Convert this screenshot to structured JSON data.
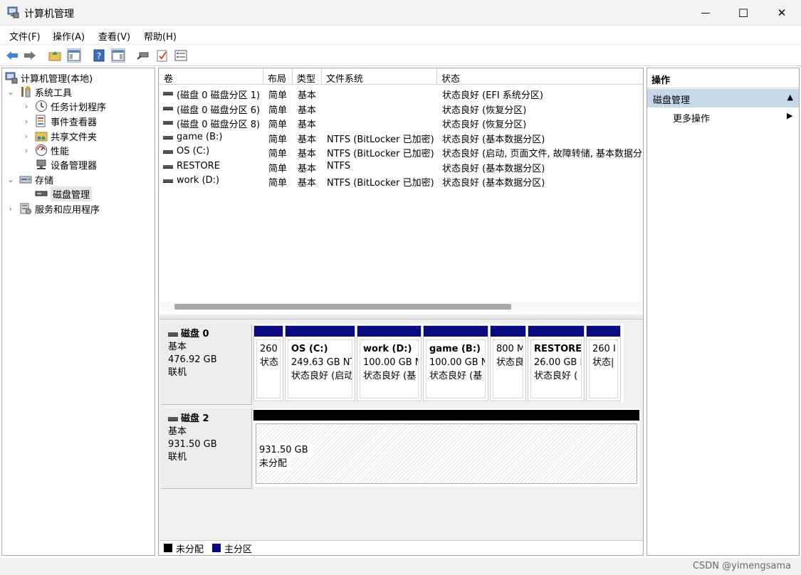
{
  "window": {
    "title": "计算机管理",
    "minimize_glyph": "—",
    "maximize_glyph": "☐",
    "close_glyph": "✕"
  },
  "menu": [
    "文件(F)",
    "操作(A)",
    "查看(V)",
    "帮助(H)"
  ],
  "tree": {
    "root": "计算机管理(本地)",
    "system_tools": "系统工具",
    "task_scheduler": "任务计划程序",
    "event_viewer": "事件查看器",
    "shared_folders": "共享文件夹",
    "performance": "性能",
    "device_manager": "设备管理器",
    "storage": "存储",
    "disk_management": "磁盘管理",
    "services": "服务和应用程序"
  },
  "columns": [
    "卷",
    "布局",
    "类型",
    "文件系统",
    "状态"
  ],
  "volumes": [
    {
      "name": "(磁盘 0 磁盘分区 1)",
      "layout": "简单",
      "type": "基本",
      "fs": "",
      "status": "状态良好 (EFI 系统分区)"
    },
    {
      "name": "(磁盘 0 磁盘分区 6)",
      "layout": "简单",
      "type": "基本",
      "fs": "",
      "status": "状态良好 (恢复分区)"
    },
    {
      "name": "(磁盘 0 磁盘分区 8)",
      "layout": "简单",
      "type": "基本",
      "fs": "",
      "status": "状态良好 (恢复分区)"
    },
    {
      "name": "game (B:)",
      "layout": "简单",
      "type": "基本",
      "fs": "NTFS (BitLocker 已加密)",
      "status": "状态良好 (基本数据分区)"
    },
    {
      "name": "OS (C:)",
      "layout": "简单",
      "type": "基本",
      "fs": "NTFS (BitLocker 已加密)",
      "status": "状态良好 (启动, 页面文件, 故障转储, 基本数据分"
    },
    {
      "name": "RESTORE",
      "layout": "简单",
      "type": "基本",
      "fs": "NTFS",
      "status": "状态良好 (基本数据分区)"
    },
    {
      "name": "work (D:)",
      "layout": "简单",
      "type": "基本",
      "fs": "NTFS (BitLocker 已加密)",
      "status": "状态良好 (基本数据分区)"
    }
  ],
  "disk0": {
    "name": "磁盘 0",
    "kind": "基本",
    "size": "476.92 GB",
    "state": "联机",
    "partitions": [
      {
        "title": "",
        "size": "260",
        "status": "状态"
      },
      {
        "title": "OS  (C:)",
        "size": "249.63 GB NT",
        "status": "状态良好 (启动"
      },
      {
        "title": "work  (D:)",
        "size": "100.00 GB N",
        "status": "状态良好 (基"
      },
      {
        "title": "game  (B:)",
        "size": "100.00 GB N",
        "status": "状态良好 (基"
      },
      {
        "title": "",
        "size": "800 M",
        "status": "状态良"
      },
      {
        "title": "RESTORE",
        "size": "26.00 GB I",
        "status": "状态良好 ("
      },
      {
        "title": "",
        "size": "260 I",
        "status": "状态|"
      }
    ]
  },
  "disk2": {
    "name": "磁盘 2",
    "kind": "基本",
    "size": "931.50 GB",
    "state": "联机",
    "unallocated": {
      "size": "931.50 GB",
      "label": "未分配"
    }
  },
  "legend": {
    "unallocated": "未分配",
    "primary": "主分区",
    "unallocated_color": "#000000",
    "primary_color": "#0b0b80"
  },
  "actions": {
    "header": "操作",
    "section": "磁盘管理",
    "more": "更多操作"
  },
  "watermark": "CSDN @yimengsama"
}
